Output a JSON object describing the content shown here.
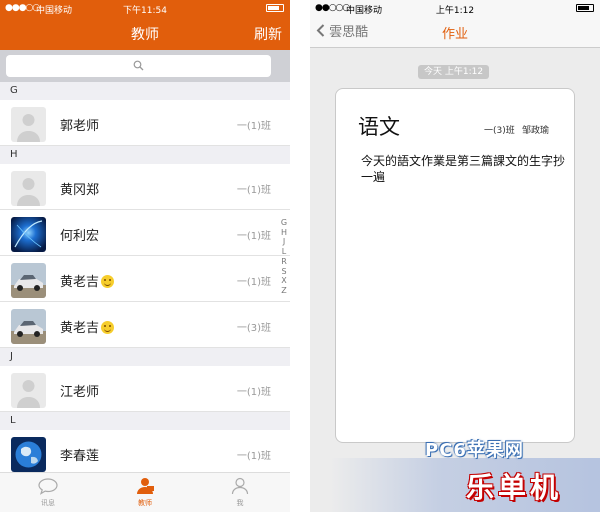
{
  "left": {
    "status": {
      "signal": "●●●○○",
      "carrier": "中国移动",
      "time": "下午11:54"
    },
    "nav": {
      "title": "教师",
      "refresh": "刷新"
    },
    "sections": [
      {
        "letter": "G",
        "rows": [
          {
            "name": "郭老师",
            "class": "一(1)班",
            "avatar": "placeholder",
            "emoji": false
          }
        ]
      },
      {
        "letter": "H",
        "rows": [
          {
            "name": "黄冈郑",
            "class": "一(1)班",
            "avatar": "placeholder",
            "emoji": false
          },
          {
            "name": "何利宏",
            "class": "一(1)班",
            "avatar": "blue",
            "emoji": false
          },
          {
            "name": "黄老吉",
            "class": "一(1)班",
            "avatar": "car",
            "emoji": true
          },
          {
            "name": "黄老吉",
            "class": "一(3)班",
            "avatar": "car",
            "emoji": true
          }
        ]
      },
      {
        "letter": "J",
        "rows": [
          {
            "name": "江老师",
            "class": "一(1)班",
            "avatar": "placeholder",
            "emoji": false
          }
        ]
      },
      {
        "letter": "L",
        "rows": [
          {
            "name": "李春莲",
            "class": "一(1)班",
            "avatar": "earth",
            "emoji": false
          }
        ]
      }
    ],
    "index": [
      "G",
      "H",
      "J",
      "L",
      "R",
      "S",
      "X",
      "Z"
    ],
    "tabs": [
      {
        "label": "讯息",
        "icon": "chat-bubble-icon"
      },
      {
        "label": "教师",
        "icon": "teacher-icon",
        "active": true
      },
      {
        "label": "我",
        "icon": "person-icon"
      }
    ]
  },
  "right": {
    "status": {
      "signal": "●●○○○",
      "carrier": "中国移动",
      "time": "上午1:12"
    },
    "nav": {
      "back": "雲思酷",
      "title": "作业"
    },
    "timestamp": "今天 上午1:12",
    "homework": {
      "subject": "语文",
      "class": "一(3)班",
      "teacher": "邹政瑜",
      "content": "今天的語文作業是第三篇課文的生字抄一遍"
    }
  },
  "watermark": {
    "site": "PC6苹果网",
    "brand": "乐单机"
  },
  "colors": {
    "accent": "#e15e0c",
    "section_bg": "#efeff3",
    "right_bg": "#ececec"
  }
}
